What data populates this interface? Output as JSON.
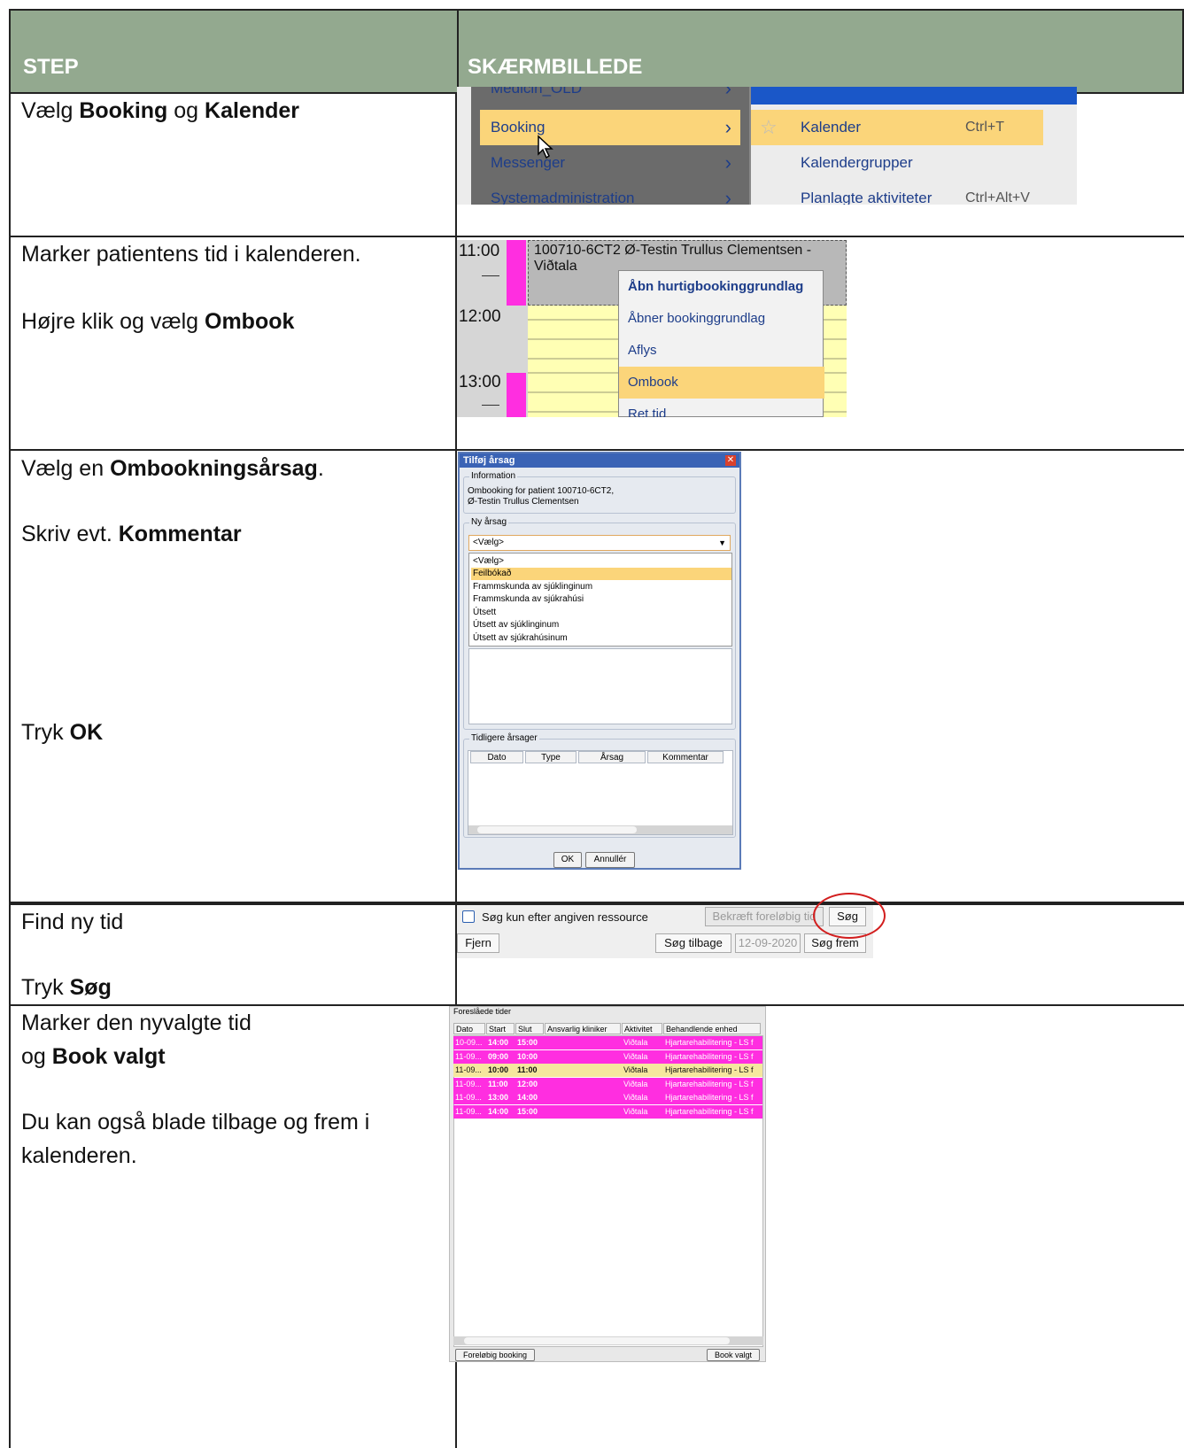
{
  "header": {
    "step": "STEP",
    "screenshot": "SKÆRMBILLEDE"
  },
  "steps": [
    {
      "lines": [
        [
          "Vælg ",
          "Booking",
          " og ",
          "Kalender",
          ""
        ]
      ]
    },
    {
      "line1": "Marker patientens tid i kalenderen.",
      "line2_pre": "Højre klik og vælg ",
      "line2_bold": "Ombook"
    },
    {
      "l1_pre": "Vælg en ",
      "l1_bold": "Ombookningsårsag",
      "l1_post": ".",
      "l2_pre": "Skriv evt. ",
      "l2_bold": "Kommentar",
      "l3_pre": "Tryk ",
      "l3_bold": "OK"
    },
    {
      "l1": "Find ny tid",
      "l2_pre": "Tryk ",
      "l2_bold": "Søg"
    },
    {
      "l1": "Marker den nyvalgte tid",
      "l2_pre": "og ",
      "l2_bold": "Book valgt",
      "l3": "Du kan også blade tilbage og frem i",
      "l4": "kalenderen."
    }
  ],
  "menu": {
    "items": [
      "Medicin_OLD",
      "Booking",
      "Messenger",
      "Systemadministration"
    ],
    "submenu": [
      {
        "label": "Kalender",
        "shortcut": "Ctrl+T"
      },
      {
        "label": "Kalendergrupper",
        "shortcut": ""
      },
      {
        "label": "Planlagte aktiviteter",
        "shortcut": "Ctrl+Alt+V"
      }
    ]
  },
  "calendar": {
    "times": [
      "11:00",
      "12:00",
      "13:00"
    ],
    "event": "100710-6CT2  Ø-Testin Trullus Clementsen - Viðtala",
    "context_menu": [
      "Åbn hurtigbookinggrundlag",
      "Åbner bookinggrundlag",
      "Aflys",
      "Ombook",
      "Ret tid"
    ]
  },
  "dialog": {
    "title": "Tilføj årsag",
    "info_label": "Information",
    "info_text1": "Ombooking for patient 100710-6CT2,",
    "info_text2": "Ø-Testin Trullus Clementsen",
    "reason_label": "Ny årsag",
    "select_value": "<Vælg>",
    "options": [
      "<Vælg>",
      "Feilbókað",
      "Frammskunda av sjúklinginum",
      "Frammskunda av sjúkrahúsi",
      "Útsett",
      "Útsett av sjúklinginum",
      "Útsett av sjúkrahúsinum"
    ],
    "previous_label": "Tidligere årsager",
    "columns": [
      "Dato",
      "Type",
      "Årsag",
      "Kommentar"
    ],
    "ok": "OK",
    "cancel": "Annullér"
  },
  "search": {
    "checkbox_label": "Søg kun efter angiven ressource",
    "confirm": "Bekræft foreløbig tid",
    "search": "Søg",
    "remove": "Fjern",
    "back": "Søg tilbage",
    "date": "12-09-2020",
    "forward": "Søg frem"
  },
  "suggested": {
    "title": "Foreslåede tider",
    "columns": [
      "Dato",
      "Start",
      "Slut",
      "Ansvarlig kliniker",
      "Aktivitet",
      "Behandlende enhed"
    ],
    "rows": [
      {
        "date": "10-09...",
        "start": "14:00",
        "end": "15:00",
        "activity": "Viðtala",
        "unit": "Hjartarehabilitering - LS f",
        "color": "#ff2ee0"
      },
      {
        "date": "11-09...",
        "start": "09:00",
        "end": "10:00",
        "activity": "Viðtala",
        "unit": "Hjartarehabilitering - LS f",
        "color": "#ff2ee0"
      },
      {
        "date": "11-09...",
        "start": "10:00",
        "end": "11:00",
        "activity": "Viðtala",
        "unit": "Hjartarehabilitering - LS f",
        "color": "#f5e79e"
      },
      {
        "date": "11-09...",
        "start": "11:00",
        "end": "12:00",
        "activity": "Viðtala",
        "unit": "Hjartarehabilitering - LS f",
        "color": "#ff2ee0"
      },
      {
        "date": "11-09...",
        "start": "13:00",
        "end": "14:00",
        "activity": "Viðtala",
        "unit": "Hjartarehabilitering - LS f",
        "color": "#ff2ee0"
      },
      {
        "date": "11-09...",
        "start": "14:00",
        "end": "15:00",
        "activity": "Viðtala",
        "unit": "Hjartarehabilitering - LS f",
        "color": "#ff2ee0"
      }
    ],
    "prelim_button": "Foreløbig booking",
    "book_button": "Book valgt"
  }
}
